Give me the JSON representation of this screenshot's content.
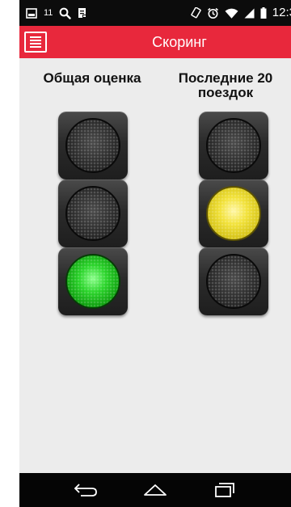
{
  "status_bar": {
    "notification_count": "11",
    "time": "12:3"
  },
  "app_bar": {
    "title": "Скоринг"
  },
  "columns": [
    {
      "title": "Общая оценка",
      "lights": [
        "off",
        "off",
        "green"
      ]
    },
    {
      "title": "Последние 20 поездок",
      "lights": [
        "off",
        "yellow",
        "off"
      ]
    }
  ],
  "colors": {
    "app_bar": "#e8283c",
    "background": "#ececec",
    "green_light": "#2bd52b",
    "yellow_light": "#f2e23a"
  },
  "icons": {
    "status_left": [
      "image-icon",
      "search-icon",
      "document-icon"
    ],
    "status_right": [
      "orientation-icon",
      "alarm-icon",
      "wifi-icon",
      "signal-icon",
      "battery-icon"
    ],
    "nav": [
      "back-icon",
      "home-icon",
      "recents-icon"
    ]
  }
}
